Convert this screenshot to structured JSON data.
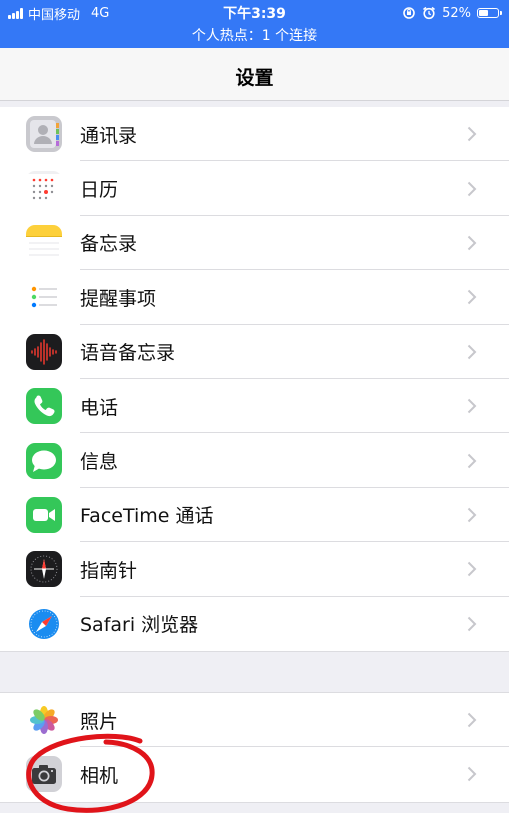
{
  "status_bar": {
    "carrier": "中国移动",
    "network": "4G",
    "time": "下午3:39",
    "battery_text": "52%",
    "battery_level": 0.52,
    "hotspot": "个人热点：1 个连接",
    "background": "#3478f6"
  },
  "nav": {
    "title": "设置"
  },
  "groups": [
    {
      "items": [
        {
          "label": "通讯录",
          "icon": "contacts-icon"
        },
        {
          "label": "日历",
          "icon": "calendar-icon"
        },
        {
          "label": "备忘录",
          "icon": "notes-icon"
        },
        {
          "label": "提醒事项",
          "icon": "reminders-icon"
        },
        {
          "label": "语音备忘录",
          "icon": "voice-memos-icon"
        },
        {
          "label": "电话",
          "icon": "phone-icon"
        },
        {
          "label": "信息",
          "icon": "messages-icon"
        },
        {
          "label": "FaceTime 通话",
          "icon": "facetime-icon"
        },
        {
          "label": "指南针",
          "icon": "compass-icon"
        },
        {
          "label": "Safari 浏览器",
          "icon": "safari-icon"
        }
      ]
    },
    {
      "items": [
        {
          "label": "照片",
          "icon": "photos-icon"
        },
        {
          "label": "相机",
          "icon": "camera-icon"
        }
      ]
    }
  ],
  "annotation": {
    "color": "#e0141a",
    "target": "相机"
  }
}
